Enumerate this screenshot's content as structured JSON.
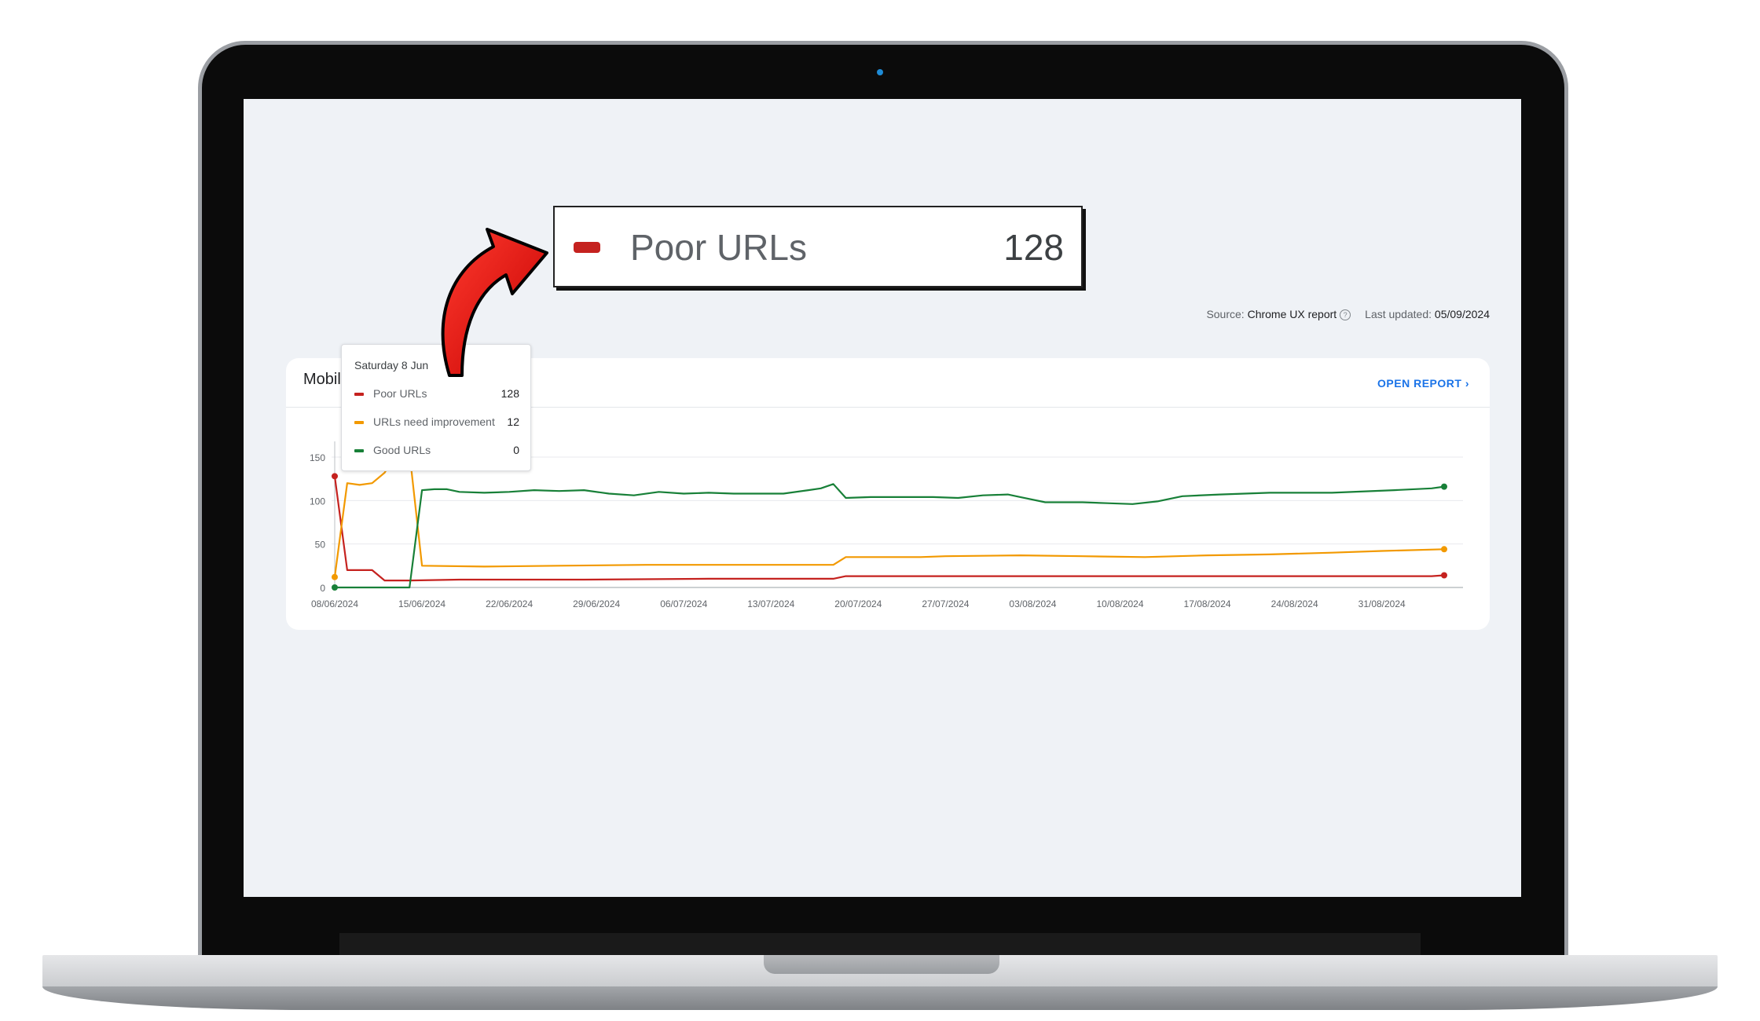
{
  "callout": {
    "label": "Poor URLs",
    "value": "128",
    "swatch_color": "#c5221f"
  },
  "source": {
    "prefix": "Source:",
    "name": "Chrome UX report",
    "help_icon": "help-circle-icon",
    "updated_prefix": "Last updated:",
    "updated_date": "05/09/2024"
  },
  "card": {
    "title": "Mobile",
    "open_report_label": "OPEN REPORT",
    "open_report_icon": "chevron-right-icon"
  },
  "tooltip": {
    "date": "Saturday 8 Jun",
    "rows": [
      {
        "label": "Poor URLs",
        "value": "128",
        "color": "#c5221f"
      },
      {
        "label": "URLs need improvement",
        "value": "12",
        "color": "#f29900"
      },
      {
        "label": "Good URLs",
        "value": "0",
        "color": "#188038"
      }
    ]
  },
  "chart_data": {
    "type": "line",
    "x_tick_labels": [
      "08/06/2024",
      "15/06/2024",
      "22/06/2024",
      "29/06/2024",
      "06/07/2024",
      "13/07/2024",
      "20/07/2024",
      "27/07/2024",
      "03/08/2024",
      "10/08/2024",
      "17/08/2024",
      "24/08/2024",
      "31/08/2024"
    ],
    "y_ticks": [
      0,
      50,
      100,
      150
    ],
    "ylim": [
      0,
      150
    ],
    "x_range_days": [
      0,
      89
    ],
    "series": [
      {
        "name": "Poor URLs",
        "color": "#c5221f",
        "points": [
          [
            0,
            128
          ],
          [
            1,
            20
          ],
          [
            2,
            20
          ],
          [
            3,
            20
          ],
          [
            4,
            8
          ],
          [
            5,
            8
          ],
          [
            6,
            8
          ],
          [
            10,
            9
          ],
          [
            20,
            9
          ],
          [
            30,
            10
          ],
          [
            40,
            10
          ],
          [
            41,
            13
          ],
          [
            50,
            13
          ],
          [
            60,
            13
          ],
          [
            70,
            13
          ],
          [
            80,
            13
          ],
          [
            88,
            13
          ],
          [
            89,
            14
          ]
        ]
      },
      {
        "name": "URLs need improvement",
        "color": "#f29900",
        "points": [
          [
            0,
            12
          ],
          [
            1,
            120
          ],
          [
            2,
            118
          ],
          [
            3,
            120
          ],
          [
            4,
            132
          ],
          [
            5,
            155
          ],
          [
            6,
            155
          ],
          [
            7,
            25
          ],
          [
            12,
            24
          ],
          [
            18,
            25
          ],
          [
            25,
            26
          ],
          [
            30,
            26
          ],
          [
            40,
            26
          ],
          [
            41,
            35
          ],
          [
            47,
            35
          ],
          [
            49,
            36
          ],
          [
            55,
            37
          ],
          [
            60,
            36
          ],
          [
            65,
            35
          ],
          [
            70,
            37
          ],
          [
            75,
            38
          ],
          [
            80,
            40
          ],
          [
            84,
            42
          ],
          [
            89,
            44
          ]
        ]
      },
      {
        "name": "Good URLs",
        "color": "#188038",
        "points": [
          [
            0,
            0
          ],
          [
            5,
            0
          ],
          [
            6,
            0
          ],
          [
            7,
            112
          ],
          [
            8,
            113
          ],
          [
            9,
            113
          ],
          [
            10,
            110
          ],
          [
            12,
            109
          ],
          [
            14,
            110
          ],
          [
            16,
            112
          ],
          [
            18,
            111
          ],
          [
            20,
            112
          ],
          [
            22,
            108
          ],
          [
            24,
            106
          ],
          [
            26,
            110
          ],
          [
            28,
            108
          ],
          [
            30,
            109
          ],
          [
            32,
            108
          ],
          [
            34,
            108
          ],
          [
            36,
            108
          ],
          [
            38,
            112
          ],
          [
            39,
            114
          ],
          [
            40,
            119
          ],
          [
            41,
            103
          ],
          [
            43,
            104
          ],
          [
            45,
            104
          ],
          [
            48,
            104
          ],
          [
            50,
            103
          ],
          [
            52,
            106
          ],
          [
            54,
            107
          ],
          [
            55,
            104
          ],
          [
            57,
            98
          ],
          [
            60,
            98
          ],
          [
            62,
            97
          ],
          [
            64,
            96
          ],
          [
            66,
            99
          ],
          [
            68,
            105
          ],
          [
            71,
            107
          ],
          [
            75,
            109
          ],
          [
            80,
            109
          ],
          [
            85,
            112
          ],
          [
            88,
            114
          ],
          [
            89,
            116
          ]
        ]
      }
    ]
  }
}
